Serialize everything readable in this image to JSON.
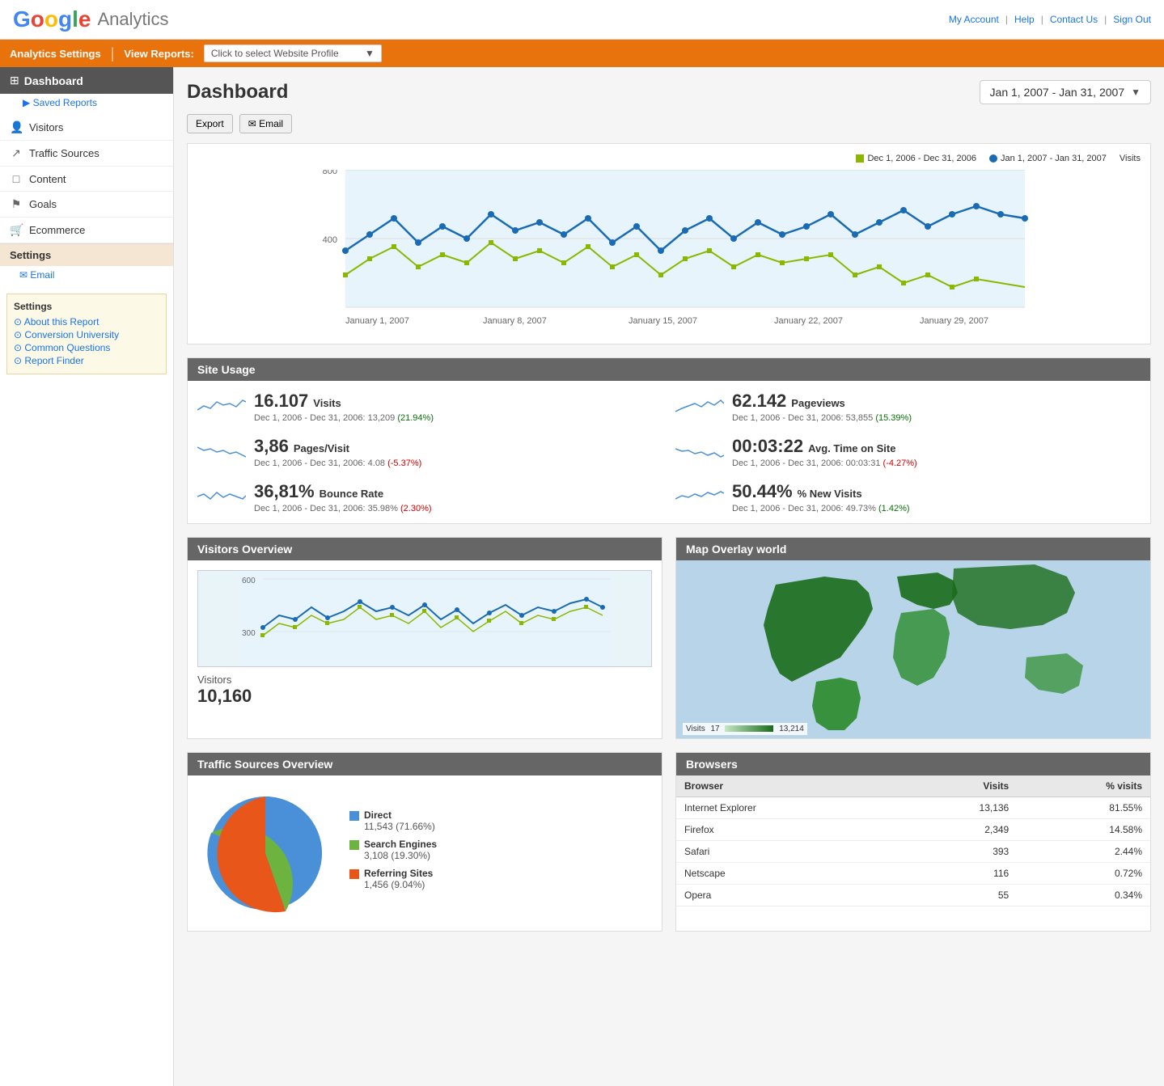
{
  "header": {
    "logo_google": "Google",
    "logo_analytics": "Analytics",
    "nav": {
      "my_account": "My Account",
      "help": "Help",
      "contact_us": "Contact Us",
      "sign_out": "Sign Out"
    }
  },
  "navbar": {
    "analytics_settings": "Analytics Settings",
    "view_reports": "View Reports:",
    "profile_placeholder": "Click to select Website Profile"
  },
  "sidebar": {
    "dashboard_label": "Dashboard",
    "saved_reports": "▶ Saved Reports",
    "nav_items": [
      {
        "id": "visitors",
        "label": "Visitors",
        "icon": "👤"
      },
      {
        "id": "traffic-sources",
        "label": "Traffic Sources",
        "icon": "↗"
      },
      {
        "id": "content",
        "label": "Content",
        "icon": "□"
      },
      {
        "id": "goals",
        "label": "Goals",
        "icon": "⚑"
      },
      {
        "id": "ecommerce",
        "label": "Ecommerce",
        "icon": "🛒"
      }
    ],
    "settings_header": "Settings",
    "settings_email": "Email",
    "help_header": "Settings",
    "help_items": [
      {
        "id": "about",
        "label": "About this Report"
      },
      {
        "id": "conversion",
        "label": "Conversion University"
      },
      {
        "id": "questions",
        "label": "Common Questions"
      },
      {
        "id": "finder",
        "label": "Report Finder"
      }
    ]
  },
  "dashboard": {
    "title": "Dashboard",
    "date_range": "Jan 1, 2007 - Jan 31, 2007",
    "export_btn": "Export",
    "email_btn": "✉ Email",
    "chart": {
      "legend_green": "Dec 1, 2006 - Dec 31, 2006",
      "legend_blue": "Jan 1, 2007 - Jan 31, 2007",
      "legend_visits": "Visits",
      "y_max": "800",
      "y_mid": "400",
      "x_labels": [
        "January 1, 2007",
        "January 8, 2007",
        "January 15, 2007",
        "January 22, 2007",
        "January 29, 2007"
      ]
    }
  },
  "site_usage": {
    "header": "Site Usage",
    "metrics": [
      {
        "value": "16.107",
        "label": "Visits",
        "comparison": "Dec 1, 2006 - Dec 31, 2006: 13,209",
        "change": "(21.94%)",
        "positive": true
      },
      {
        "value": "62.142",
        "label": "Pageviews",
        "comparison": "Dec 1, 2006 - Dec 31, 2006: 53,855",
        "change": "(15.39%)",
        "positive": true
      },
      {
        "value": "3,86",
        "label": "Pages/Visit",
        "comparison": "Dec 1, 2006 - Dec 31, 2006: 4.08",
        "change": "(-5.37%)",
        "positive": false
      },
      {
        "value": "00:03:22",
        "label": "Avg. Time on Site",
        "comparison": "Dec 1, 2006 - Dec 31, 2006: 00:03:31",
        "change": "(-4.27%)",
        "positive": false
      },
      {
        "value": "36,81%",
        "label": "Bounce Rate",
        "comparison": "Dec 1, 2006 - Dec 31, 2006: 35.98%",
        "change": "(2.30%)",
        "positive": false
      },
      {
        "value": "50.44%",
        "label": "% New Visits",
        "comparison": "Dec 1, 2006 - Dec 31, 2006: 49.73%",
        "change": "(1.42%)",
        "positive": true
      }
    ]
  },
  "visitors_overview": {
    "header": "Visitors Overview",
    "label": "Visitors",
    "value": "10,160",
    "y_top": "600",
    "y_bot": "300"
  },
  "map_overlay": {
    "header": "Map Overlay world",
    "legend_min": "Visits",
    "legend_val1": "17",
    "legend_val2": "13,214"
  },
  "traffic_sources": {
    "header": "Traffic Sources Overview",
    "items": [
      {
        "color": "#4a90d9",
        "label": "Direct",
        "detail": "11,543 (71.66%)"
      },
      {
        "color": "#6db33f",
        "label": "Search Engines",
        "detail": "3,108 (19.30%)"
      },
      {
        "color": "#e8561a",
        "label": "Referring Sites",
        "detail": "1,456 (9.04%)"
      }
    ]
  },
  "browsers": {
    "header": "Browsers",
    "columns": [
      "Browser",
      "Visits",
      "% visits"
    ],
    "rows": [
      {
        "browser": "Internet Explorer",
        "visits": "13,136",
        "pct": "81.55%"
      },
      {
        "browser": "Firefox",
        "visits": "2,349",
        "pct": "14.58%"
      },
      {
        "browser": "Safari",
        "visits": "393",
        "pct": "2.44%"
      },
      {
        "browser": "Netscape",
        "visits": "116",
        "pct": "0.72%"
      },
      {
        "browser": "Opera",
        "visits": "55",
        "pct": "0.34%"
      }
    ]
  }
}
